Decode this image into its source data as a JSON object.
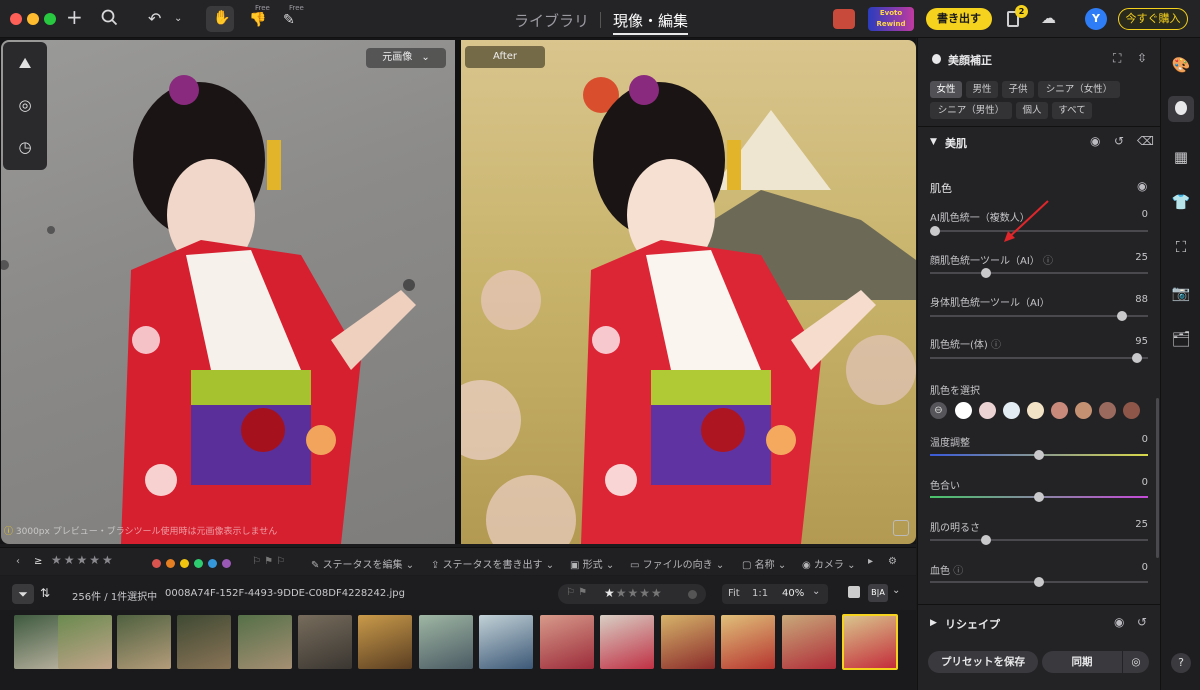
{
  "topbar": {
    "tabs": [
      {
        "label": "ライブラリ"
      },
      {
        "label": "現像・編集"
      }
    ],
    "free_badge": "Free",
    "evoto_rewind": "Evoto Rewind",
    "export_button": "書き出す",
    "notif_count": "2",
    "avatar": "Y",
    "buy_button": "今すぐ購入"
  },
  "canvas": {
    "before_label": "元画像",
    "after_label": "After",
    "preview_note": "3000px プレビュー・ブラシツール使用時は元画像表示しません"
  },
  "filmstrip_toolbar": {
    "edit_status": "ステータスを編集",
    "export_status": "ステータスを書き出す",
    "format": "形式",
    "orientation": "ファイルの向き",
    "name": "名称",
    "camera": "カメラ",
    "colors": [
      "#d9534f",
      "#e67e22",
      "#f1c40f",
      "#2ecc71",
      "#3498db",
      "#9b59b6"
    ]
  },
  "info_bar": {
    "count": "256件 / 1件選択中",
    "filename": "0008A74F-152F-4493-9DDE-C08DF4228242.jpg",
    "fit": "Fit",
    "one_to_one": "1:1",
    "zoom": "40%",
    "ba": "B|A"
  },
  "panel": {
    "title": "美顔補正",
    "filters": [
      {
        "label": "女性",
        "selected": true
      },
      {
        "label": "男性",
        "selected": false
      },
      {
        "label": "子供",
        "selected": false
      },
      {
        "label": "シニア（女性）",
        "selected": false
      },
      {
        "label": "シニア（男性）",
        "selected": false
      },
      {
        "label": "個人",
        "selected": false
      },
      {
        "label": "すべて",
        "selected": false
      }
    ],
    "section_skin": "美肌",
    "skin_color": "肌色",
    "sliders": [
      {
        "label": "AI肌色統一（複数人）",
        "value": "0"
      },
      {
        "label": "顔肌色統一ツール（AI）",
        "value": "25"
      },
      {
        "label": "身体肌色統一ツール（AI）",
        "value": "88"
      },
      {
        "label": "肌色統一(体)",
        "value": "95"
      }
    ],
    "select_skin": "肌色を選択",
    "swatches": [
      "#ffffff",
      "#ecd3d3",
      "#e2ecf2",
      "#f3e3c6",
      "#c98a7c",
      "#c49272",
      "#9a6a5e",
      "#8e5648"
    ],
    "sliders2": [
      {
        "label": "温度調整",
        "value": "0"
      },
      {
        "label": "色合い",
        "value": "0"
      },
      {
        "label": "肌の明るさ",
        "value": "25"
      },
      {
        "label": "血色",
        "value": "0"
      }
    ],
    "reshape": "リシェイプ",
    "save_preset": "プリセットを保存",
    "sync": "同期"
  }
}
